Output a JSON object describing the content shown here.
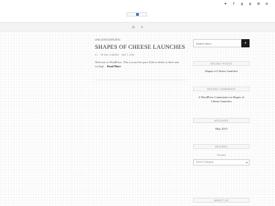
{
  "social": {
    "icons": [
      "twitter-icon",
      "facebook-icon",
      "googleplus-icon",
      "pinterest-icon",
      "dribbble-icon",
      "rss-icon"
    ],
    "glyphs": [
      "✦",
      "f",
      "g",
      "p",
      "⊛",
      "≋"
    ]
  },
  "nav": {
    "cart_glyph": "⌂",
    "search_glyph": "⌕"
  },
  "post": {
    "category": "UNCATEGORIZED",
    "title": "SHAPES OF CHEESE LAUNCHES",
    "meta_heart": "♥ 1",
    "meta_author": "BY BILL & SARAH",
    "meta_date": "MAY 7, 2015",
    "excerpt": "Welcome to WordPress. This is your first post. Edit or delete it, then start writing! –",
    "read_more": "Read More"
  },
  "sidebar": {
    "search_placeholder": "Search here...",
    "search_glyph": "⌕",
    "recent_posts_title": "RECENT POSTS",
    "recent_post_1": "Shapes of Cheese Launches",
    "recent_comments_title": "RECENT COMMENTS",
    "recent_comment_1": "A WordPress Commenter on Shapes of Cheese Launches",
    "archives_title": "ARCHIVES",
    "archive_1": "May 2015",
    "recipes_title": "RECIPES",
    "recipes_label": "Recipes",
    "recipes_select": "Select Category",
    "about_title": "ABOUT US"
  }
}
